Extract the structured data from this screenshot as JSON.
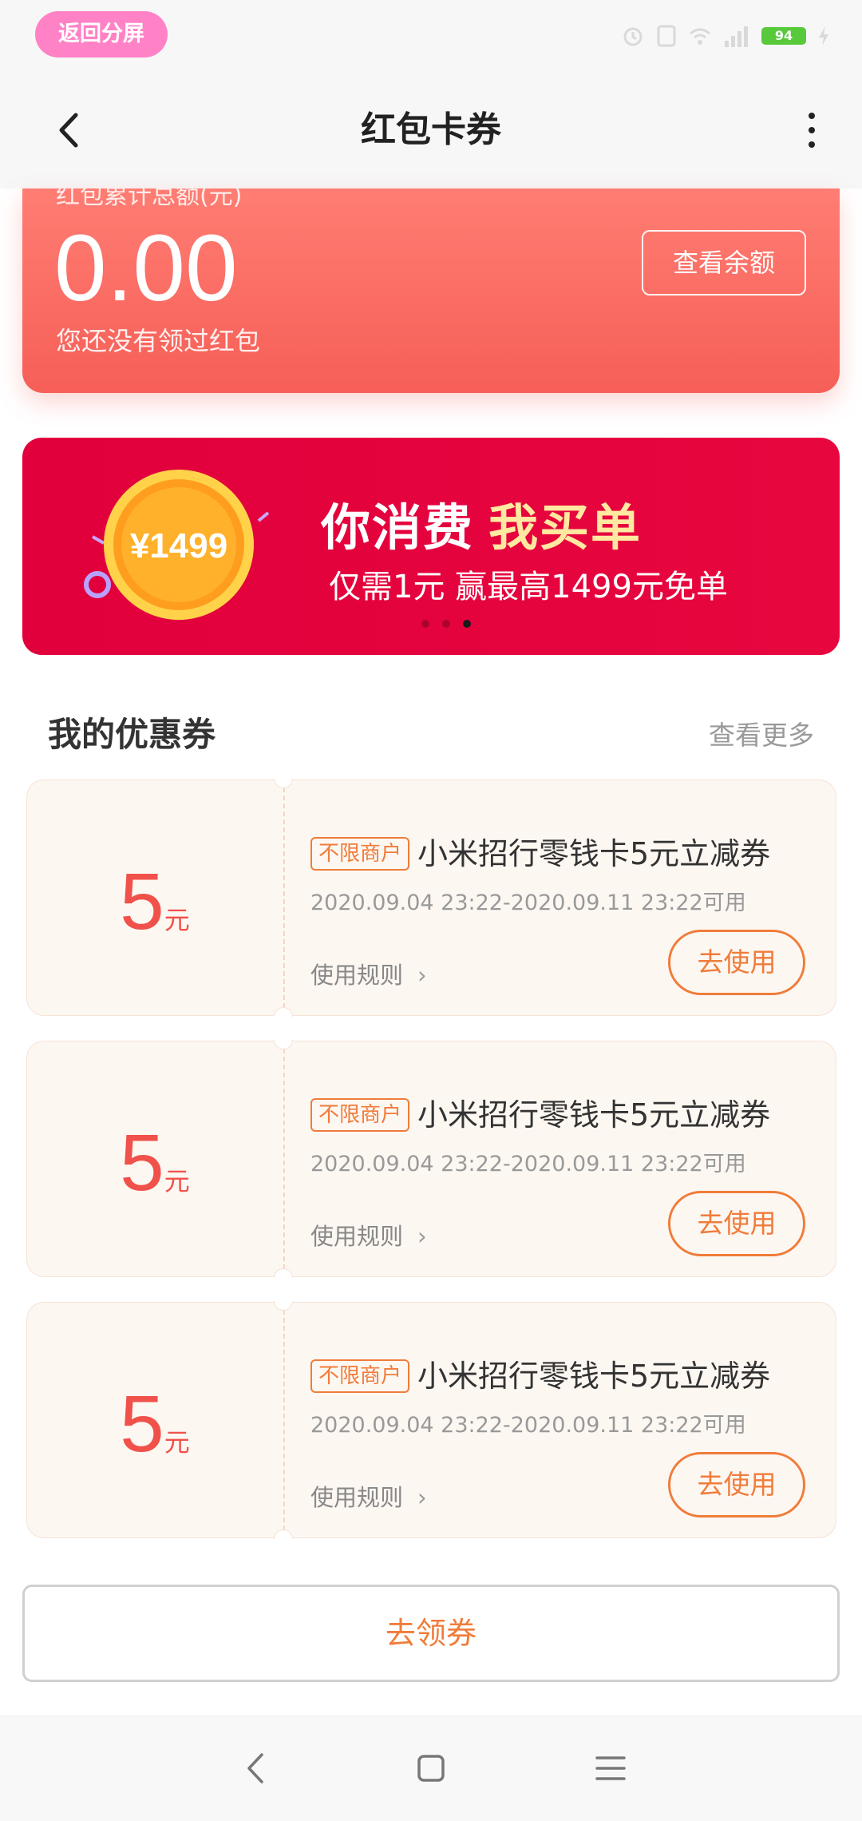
{
  "status_bar": {
    "back_split_label": "返回分屏",
    "battery_level": "94",
    "icons": [
      "alarm-icon",
      "sim-icon",
      "wifi-icon",
      "signal-icon",
      "battery-icon",
      "charging-icon"
    ]
  },
  "nav": {
    "title": "红包卡券",
    "back_icon": "chevron-left-icon",
    "more_icon": "more-vertical-icon"
  },
  "red_packet": {
    "label": "红包累计总额(元)",
    "amount": "0.00",
    "note": "您还没有领过红包",
    "balance_button": "查看余额"
  },
  "banner": {
    "coin_text": "¥1499",
    "title_part1": "你消费",
    "title_part2": "我买单",
    "subtitle": "仅需1元 赢最高1499元免单",
    "dots_total": 3,
    "active_dot": 3
  },
  "coupons_section": {
    "title": "我的优惠券",
    "see_more": "查看更多",
    "items": [
      {
        "value": "5",
        "unit": "元",
        "tag": "不限商户",
        "name": "小米招行零钱卡5元立减券",
        "validity": "2020.09.04 23:22-2020.09.11 23:22可用",
        "rules": "使用规则",
        "use_button": "去使用"
      },
      {
        "value": "5",
        "unit": "元",
        "tag": "不限商户",
        "name": "小米招行零钱卡5元立减券",
        "validity": "2020.09.04 23:22-2020.09.11 23:22可用",
        "rules": "使用规则",
        "use_button": "去使用"
      },
      {
        "value": "5",
        "unit": "元",
        "tag": "不限商户",
        "name": "小米招行零钱卡5元立减券",
        "validity": "2020.09.04 23:22-2020.09.11 23:22可用",
        "rules": "使用规则",
        "use_button": "去使用"
      }
    ]
  },
  "get_coupons_button": "去领券",
  "system_nav": {
    "back_icon": "back-triangle-icon",
    "home_icon": "home-square-icon",
    "menu_icon": "menu-lines-icon"
  },
  "colors": {
    "accent_orange": "#f07c3a",
    "coupon_red": "#f0514a",
    "banner_red": "#e1003c",
    "packet_red": "#f65f57",
    "split_pink": "#ff82c6"
  }
}
